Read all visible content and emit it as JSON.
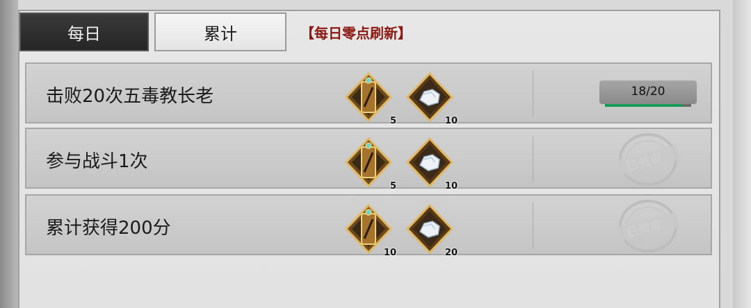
{
  "tabs": {
    "daily_label": "每日",
    "total_label": "累计"
  },
  "refresh_notice": "【每日零点刷新】",
  "tasks": [
    {
      "title": "击败20次五毒教长老",
      "rewards": [
        {
          "icon": "bronze-token-icon",
          "qty": "5"
        },
        {
          "icon": "silver-ore-icon",
          "qty": "10"
        }
      ],
      "status": "progress",
      "progress_text": "18/20",
      "progress_fraction": 0.9
    },
    {
      "title": "参与战斗1次",
      "rewards": [
        {
          "icon": "bronze-token-icon",
          "qty": "5"
        },
        {
          "icon": "silver-ore-icon",
          "qty": "10"
        }
      ],
      "status": "claimed",
      "claimed_text": "已领取"
    },
    {
      "title": "累计获得200分",
      "rewards": [
        {
          "icon": "bronze-token-icon",
          "qty": "10"
        },
        {
          "icon": "silver-ore-icon",
          "qty": "20"
        }
      ],
      "status": "claimed",
      "claimed_text": "已领取"
    }
  ],
  "colors": {
    "notice": "#8b1a12",
    "progress_fill": "#1a9a58",
    "active_tab": "#2e2e2e"
  }
}
